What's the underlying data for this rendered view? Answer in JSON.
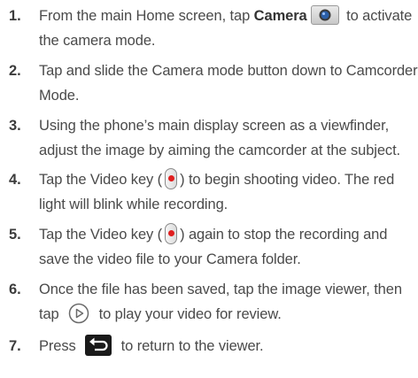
{
  "steps": [
    {
      "number": "1.",
      "line1_before": "From the main Home screen, tap ",
      "line1_bold": "Camera",
      "line1_after": " to activate",
      "line2": "the camera mode.",
      "icon": "camera-app-icon"
    },
    {
      "number": "2.",
      "line1": "Tap and slide the Camera mode button down to Camcorder",
      "line2": "Mode."
    },
    {
      "number": "3.",
      "line1": "Using the phone’s main display screen as a viewfinder,",
      "line2": "adjust the image by aiming the camcorder at the subject."
    },
    {
      "number": "4.",
      "line1_before": "Tap the Video key (",
      "line1_after": ") to begin shooting video. The red",
      "line2": "light will blink while recording.",
      "icon": "video-record-key-icon"
    },
    {
      "number": "5.",
      "line1_before": "Tap the Video key (",
      "line1_after": ") again to stop the recording and",
      "line2": "save the video file to your Camera folder.",
      "icon": "video-record-key-icon"
    },
    {
      "number": "6.",
      "line1": "Once the file has been saved, tap the image viewer, then",
      "line2_before": "tap ",
      "line2_after": " to play your video for review.",
      "icon": "play-circle-icon"
    },
    {
      "number": "7.",
      "line1_before": "Press ",
      "line1_after": " to return to the viewer.",
      "icon": "back-arrow-icon"
    }
  ],
  "colors": {
    "text": "#4a4a4a",
    "record_dot": "#e01e1e",
    "back_button": "#1a1a1a"
  }
}
